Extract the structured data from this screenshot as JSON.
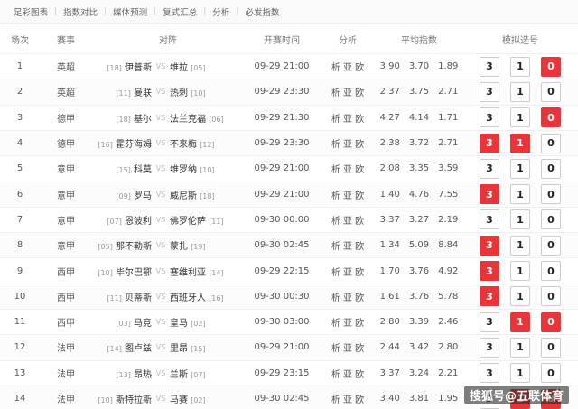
{
  "nav": [
    "足彩图表",
    "指数对比",
    "媒体预测",
    "复式汇总",
    "分析",
    "必发指数"
  ],
  "headers": {
    "no": "场次",
    "league": "赛事",
    "match": "对阵",
    "time": "开赛时间",
    "analysis": "分析",
    "odds": "平均指数",
    "pick": "模拟选号"
  },
  "analysis_label": "析 亚 欧",
  "vs_label": "VS",
  "rows": [
    {
      "no": "1",
      "league": "英超",
      "home_rank": "[18]",
      "home": "伊普斯",
      "away": "维拉",
      "away_rank": "[05]",
      "time": "09-29 21:00",
      "odds": [
        "3.90",
        "3.70",
        "1.89"
      ],
      "picks": [
        "3",
        "1",
        "0"
      ],
      "active": [
        false,
        false,
        true
      ]
    },
    {
      "no": "2",
      "league": "英超",
      "home_rank": "[11]",
      "home": "曼联",
      "away": "热刺",
      "away_rank": "[10]",
      "time": "09-29 23:30",
      "odds": [
        "2.37",
        "3.75",
        "2.71"
      ],
      "picks": [
        "3",
        "1",
        "0"
      ],
      "active": [
        false,
        false,
        false
      ]
    },
    {
      "no": "3",
      "league": "德甲",
      "home_rank": "[18]",
      "home": "基尔",
      "away": "法兰克福",
      "away_rank": "[06]",
      "time": "09-29 21:30",
      "odds": [
        "4.27",
        "4.14",
        "1.71"
      ],
      "picks": [
        "3",
        "1",
        "0"
      ],
      "active": [
        false,
        false,
        true
      ]
    },
    {
      "no": "4",
      "league": "德甲",
      "home_rank": "[16]",
      "home": "霍芬海姆",
      "away": "不来梅",
      "away_rank": "[12]",
      "time": "09-29 23:30",
      "odds": [
        "2.38",
        "3.72",
        "2.71"
      ],
      "picks": [
        "3",
        "1",
        "0"
      ],
      "active": [
        true,
        true,
        false
      ]
    },
    {
      "no": "5",
      "league": "意甲",
      "home_rank": "[15]",
      "home": "科莫",
      "away": "维罗纳",
      "away_rank": "[10]",
      "time": "09-29 21:00",
      "odds": [
        "2.08",
        "3.35",
        "3.59"
      ],
      "picks": [
        "3",
        "1",
        "0"
      ],
      "active": [
        false,
        false,
        false
      ]
    },
    {
      "no": "6",
      "league": "意甲",
      "home_rank": "[09]",
      "home": "罗马",
      "away": "威尼斯",
      "away_rank": "[18]",
      "time": "09-29 21:00",
      "odds": [
        "1.40",
        "4.76",
        "7.55"
      ],
      "picks": [
        "3",
        "1",
        "0"
      ],
      "active": [
        true,
        false,
        false
      ]
    },
    {
      "no": "7",
      "league": "意甲",
      "home_rank": "[07]",
      "home": "恩波利",
      "away": "佛罗伦萨",
      "away_rank": "[11]",
      "time": "09-30 00:00",
      "odds": [
        "3.37",
        "3.27",
        "2.19"
      ],
      "picks": [
        "3",
        "1",
        "0"
      ],
      "active": [
        false,
        false,
        false
      ]
    },
    {
      "no": "8",
      "league": "意甲",
      "home_rank": "[05]",
      "home": "那不勒斯",
      "away": "蒙扎",
      "away_rank": "[19]",
      "time": "09-30 02:45",
      "odds": [
        "1.34",
        "5.09",
        "8.84"
      ],
      "picks": [
        "3",
        "1",
        "0"
      ],
      "active": [
        true,
        false,
        false
      ]
    },
    {
      "no": "9",
      "league": "西甲",
      "home_rank": "[10]",
      "home": "毕尔巴鄂",
      "away": "塞维利亚",
      "away_rank": "[14]",
      "time": "09-29 22:15",
      "odds": [
        "1.70",
        "3.76",
        "4.92"
      ],
      "picks": [
        "3",
        "1",
        "0"
      ],
      "active": [
        true,
        false,
        false
      ]
    },
    {
      "no": "10",
      "league": "西甲",
      "home_rank": "[11]",
      "home": "贝蒂斯",
      "away": "西班牙人",
      "away_rank": "[16]",
      "time": "09-30 00:30",
      "odds": [
        "1.61",
        "3.76",
        "5.78"
      ],
      "picks": [
        "3",
        "1",
        "0"
      ],
      "active": [
        true,
        false,
        false
      ]
    },
    {
      "no": "11",
      "league": "西甲",
      "home_rank": "[03]",
      "home": "马竞",
      "away": "皇马",
      "away_rank": "[02]",
      "time": "09-30 03:00",
      "odds": [
        "2.80",
        "3.39",
        "2.46"
      ],
      "picks": [
        "3",
        "1",
        "0"
      ],
      "active": [
        false,
        true,
        true
      ]
    },
    {
      "no": "12",
      "league": "法甲",
      "home_rank": "[14]",
      "home": "图卢兹",
      "away": "里昂",
      "away_rank": "[15]",
      "time": "09-29 21:00",
      "odds": [
        "2.44",
        "3.42",
        "2.80"
      ],
      "picks": [
        "3",
        "1",
        "0"
      ],
      "active": [
        false,
        false,
        false
      ]
    },
    {
      "no": "13",
      "league": "法甲",
      "home_rank": "[13]",
      "home": "昂热",
      "away": "兰斯",
      "away_rank": "[07]",
      "time": "09-29 23:15",
      "odds": [
        "3.37",
        "3.24",
        "2.21"
      ],
      "picks": [
        "3",
        "1",
        "0"
      ],
      "active": [
        false,
        false,
        false
      ]
    },
    {
      "no": "14",
      "league": "法甲",
      "home_rank": "[10]",
      "home": "斯特拉斯",
      "away": "马赛",
      "away_rank": "[02]",
      "time": "09-30 02:45",
      "odds": [
        "3.40",
        "3.81",
        "1.95"
      ],
      "picks": [
        "3",
        "1",
        "0"
      ],
      "active": [
        false,
        true,
        true
      ]
    }
  ],
  "watermark": "搜狐号@五联体育",
  "colors": {
    "accent": "#e8353a"
  }
}
